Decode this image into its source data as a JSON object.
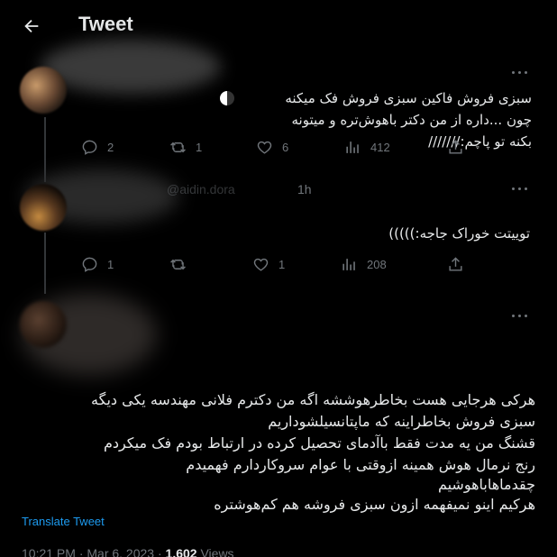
{
  "header": {
    "title": "Tweet"
  },
  "tweets": [
    {
      "text": "سبزی فروش فاکین سبزی فروش فک میکنه چون ...داره از من دکتر باهوش‌تره و میتونه بکنه تو پاچم:///////",
      "actions": {
        "replies": "2",
        "retweets": "1",
        "likes": "6",
        "views": "412"
      }
    },
    {
      "author_partial": "@aidin.dora",
      "time": "1h",
      "text": "توییتت خوراک جاجه:)))))",
      "actions": {
        "replies": "1",
        "retweets": "",
        "likes": "1",
        "views": "208"
      }
    }
  ],
  "main_tweet": {
    "text_lines": [
      "هرکی هرجایی هست بخاطرهوششه اگه من دکترم فلانی مهندسه یکی دیگه",
      "سبزی فروش بخاطراینه که ماپتانسیلشوداریم",
      "قشنگ من یه مدت فقط باآدمای تحصیل کرده در ارتباط بودم فک میکردم",
      "رنج نرمال هوش همینه ازوقتی با عوام سروکاردارم فهمیدم",
      "چقدماهاباهوشیم",
      "هرکیم اینو نمیفهمه ازون سبزی فروشه هم کم‌هوشتره"
    ],
    "translate_label": "Translate Tweet",
    "timestamp": "10:21 PM · Mar 6, 2023 ·",
    "views_count": "1,602",
    "views_label": "Views"
  },
  "colors": {
    "background": "#000000",
    "text": "#e7e9ea",
    "muted": "#71767b",
    "link": "#1d9bf0",
    "line": "#333639"
  }
}
